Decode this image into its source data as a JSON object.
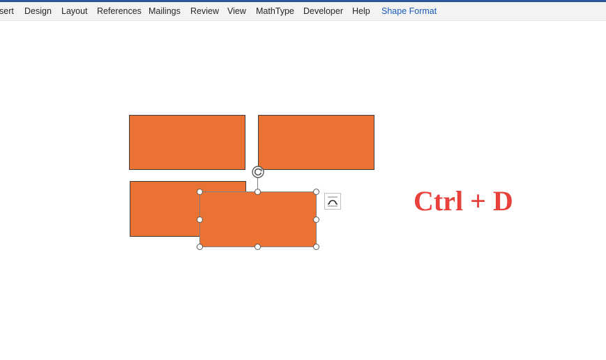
{
  "ribbon": {
    "tabs": [
      {
        "label": "sert"
      },
      {
        "label": "Design"
      },
      {
        "label": "Layout"
      },
      {
        "label": "References"
      },
      {
        "label": "Mailings"
      },
      {
        "label": "Review"
      },
      {
        "label": "View"
      },
      {
        "label": "MathType"
      },
      {
        "label": "Developer"
      },
      {
        "label": "Help"
      },
      {
        "label": "Shape Format"
      }
    ],
    "active_tab": "Shape Format"
  },
  "canvas": {
    "shortcut_text": "Ctrl + D",
    "selected_shape_icons": {
      "rotation_handle": "rotate-icon",
      "layout_options": "layout-options-icon"
    }
  },
  "colors": {
    "title_bar": "#2b579a",
    "ribbon_bg": "#f3f3f3",
    "shape_fill": "#ea7233",
    "shape_border": "#3d3d3d",
    "shortcut_text": "#e8413b",
    "active_tab": "#185abd"
  }
}
